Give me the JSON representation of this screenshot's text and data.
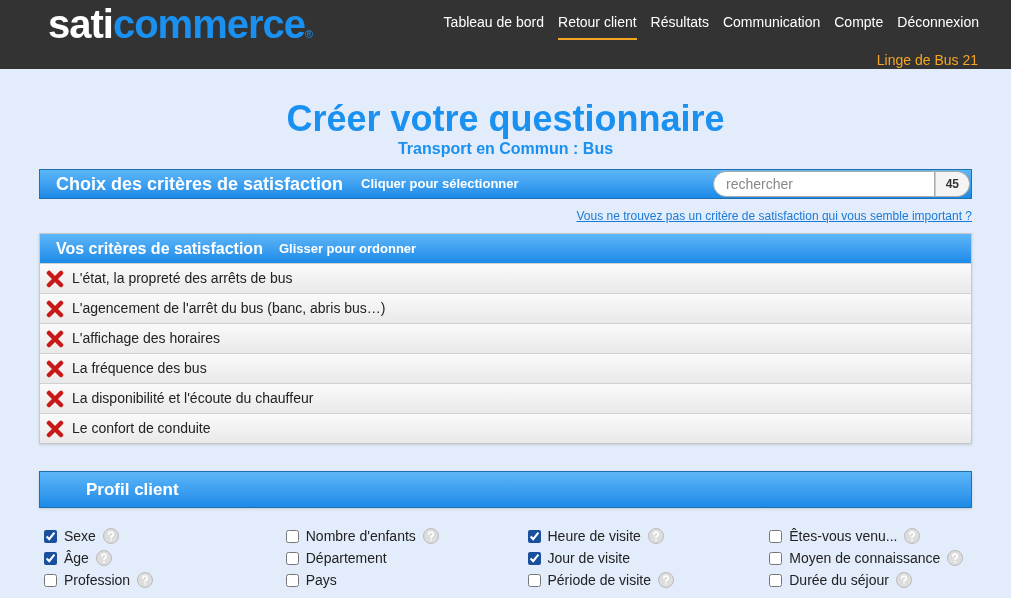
{
  "logo": {
    "part_1": "sati",
    "part_2": "commerce",
    "mark": "®"
  },
  "nav": [
    {
      "label": "Tableau de bord",
      "selected": false
    },
    {
      "label": "Retour client",
      "selected": true
    },
    {
      "label": "Résultats",
      "selected": false
    },
    {
      "label": "Communication",
      "selected": false
    },
    {
      "label": "Compte",
      "selected": false
    },
    {
      "label": "Déconnexion",
      "selected": false
    }
  ],
  "account": "Linge de Bus 21",
  "title": "Créer votre questionnaire",
  "subtitle": "Transport en Commun : Bus",
  "choice_bar": {
    "title": "Choix des critères de satisfaction",
    "hint": "Cliquer pour sélectionner",
    "search_placeholder": "rechercher",
    "count": "45"
  },
  "missing_link": "Vous ne trouvez pas un critère de satisfaction qui vous semble important ?",
  "criteria": {
    "title": "Vos critères de satisfaction",
    "hint": "Glisser pour ordonner",
    "items": [
      "L'état, la propreté des arrêts de bus",
      "L'agencement de l'arrêt du bus (banc, abris bus…)",
      "L'affichage des horaires",
      "La fréquence des bus",
      "La disponibilité et l'écoute du chauffeur",
      "Le confort de conduite"
    ]
  },
  "profile": {
    "title": "Profil client",
    "columns": [
      [
        {
          "label": "Sexe",
          "checked": true,
          "help": true
        },
        {
          "label": "Âge",
          "checked": true,
          "help": true
        },
        {
          "label": "Profession",
          "checked": false,
          "help": true
        }
      ],
      [
        {
          "label": "Nombre d'enfants",
          "checked": false,
          "help": true
        },
        {
          "label": "Département",
          "checked": false,
          "help": false
        },
        {
          "label": "Pays",
          "checked": false,
          "help": false
        }
      ],
      [
        {
          "label": "Heure de visite",
          "checked": true,
          "help": true
        },
        {
          "label": "Jour de visite",
          "checked": true,
          "help": false
        },
        {
          "label": "Période de visite",
          "checked": false,
          "help": true
        }
      ],
      [
        {
          "label": "Êtes-vous venu...",
          "checked": false,
          "help": true
        },
        {
          "label": "Moyen de connaissance",
          "checked": false,
          "help": true
        },
        {
          "label": "Durée du séjour",
          "checked": false,
          "help": true
        }
      ]
    ]
  }
}
